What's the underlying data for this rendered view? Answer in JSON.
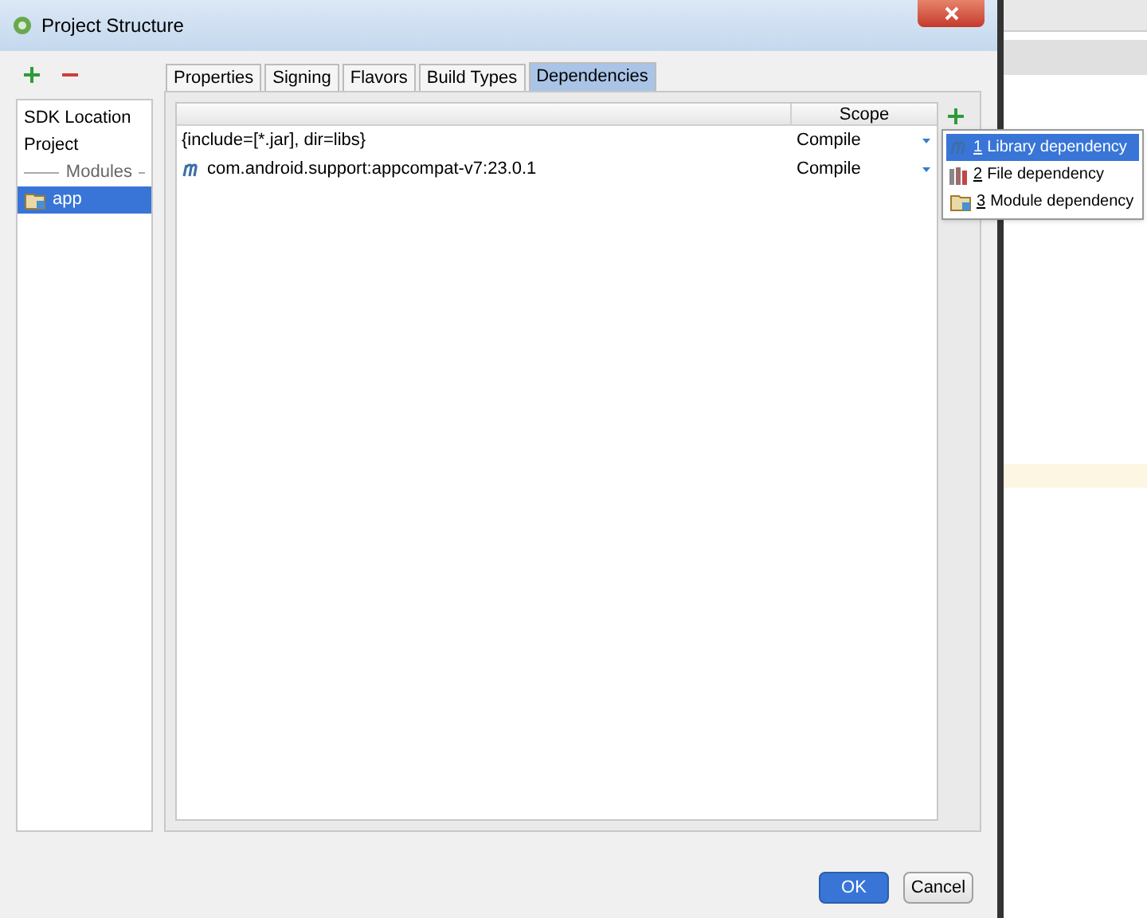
{
  "window": {
    "title": "Project Structure"
  },
  "sidebar": {
    "items": [
      {
        "label": "SDK Location",
        "kind": "item",
        "selected": false
      },
      {
        "label": "Project",
        "kind": "item",
        "selected": false
      },
      {
        "label": "Modules",
        "kind": "separator"
      },
      {
        "label": "app",
        "kind": "module",
        "selected": true
      }
    ]
  },
  "tabs": [
    {
      "label": "Properties",
      "selected": false
    },
    {
      "label": "Signing",
      "selected": false
    },
    {
      "label": "Flavors",
      "selected": false
    },
    {
      "label": "Build Types",
      "selected": false
    },
    {
      "label": "Dependencies",
      "selected": true
    }
  ],
  "table": {
    "columns": [
      "Scope"
    ],
    "rows": [
      {
        "kind": "file",
        "name": "{include=[*.jar], dir=libs}",
        "scope": "Compile"
      },
      {
        "kind": "library",
        "name": "com.android.support:appcompat-v7:23.0.1",
        "scope": "Compile"
      }
    ]
  },
  "add_menu": {
    "items": [
      {
        "kind": "library",
        "mnemonic": "1",
        "label": "Library dependency",
        "selected": true
      },
      {
        "kind": "file",
        "mnemonic": "2",
        "label": "File dependency",
        "selected": false
      },
      {
        "kind": "module",
        "mnemonic": "3",
        "label": "Module dependency",
        "selected": false
      }
    ]
  },
  "buttons": [
    {
      "label": "OK",
      "kind": "primary"
    },
    {
      "label": "Cancel",
      "kind": "secondary"
    }
  ]
}
